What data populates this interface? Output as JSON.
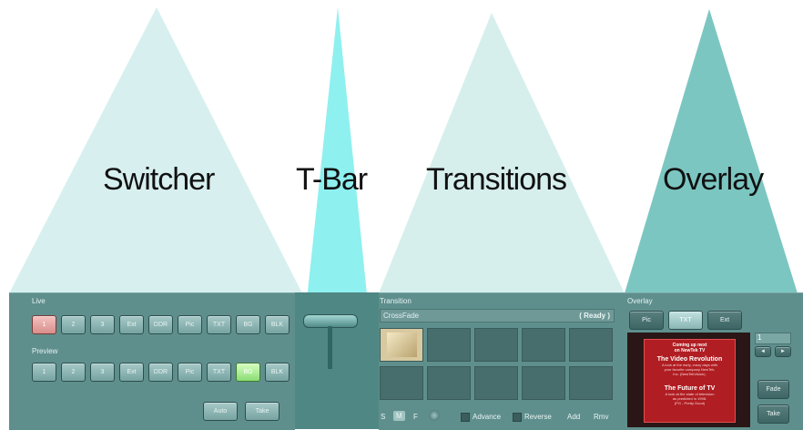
{
  "labels": {
    "switcher": "Switcher",
    "tbar": "T-Bar",
    "transitions": "Transitions",
    "overlay": "Overlay"
  },
  "colors": {
    "switcher_cone": "#d7f0ef",
    "tbar_cone": "#8ef0ef",
    "transitions_cone": "#d6efed",
    "overlay_cone": "#7cc6c1",
    "panel": "#5f8f8d",
    "live_active": "#e7a8a5",
    "preview_active": "#a9ef8f"
  },
  "switcher": {
    "live_label": "Live",
    "preview_label": "Preview",
    "buttons": [
      "1",
      "2",
      "3",
      "Ext",
      "DDR",
      "Pic",
      "TXT",
      "BG",
      "BLK"
    ],
    "live_active": "1",
    "preview_active": "BG",
    "auto_label": "Auto",
    "take_label": "Take"
  },
  "transition": {
    "label": "Transition",
    "name": "CrossFade",
    "status": "( Ready )",
    "speed_buttons": [
      "S",
      "M",
      "F"
    ],
    "selected_speed": "M",
    "advance_label": "Advance",
    "reverse_label": "Reverse",
    "add_label": "Add",
    "remove_label": "Rmv"
  },
  "overlay": {
    "label": "Overlay",
    "tabs": [
      "Pic",
      "TXT",
      "Ext"
    ],
    "selected_tab": "TXT",
    "number_value": "1",
    "prev_arrow": "◄",
    "next_arrow": "►",
    "fade_label": "Fade",
    "take_label": "Take",
    "preview_lines": [
      "Coming up next",
      "on NewTek TV",
      "The Video Revolution",
      "A look at the early, crazy days with",
      "your favorite company NewTek,",
      "Inc. (NewTekVision).",
      "The Future of TV",
      "A look at the state of television",
      "as predicted in 1998.",
      "(PG - Pretty Good)"
    ]
  }
}
